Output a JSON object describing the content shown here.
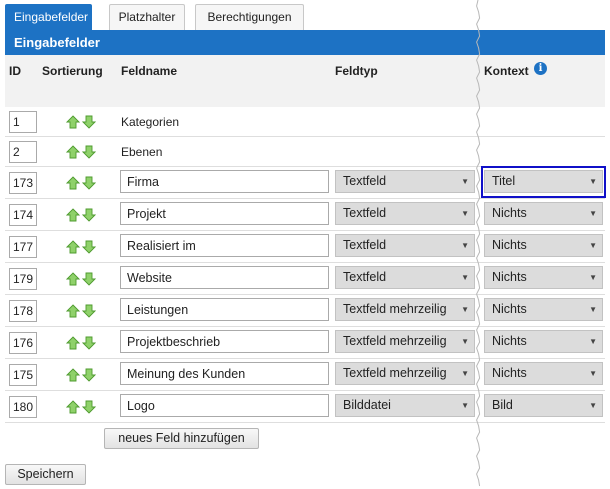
{
  "tabs": [
    {
      "label": "Eingabefelder",
      "active": true
    },
    {
      "label": "Platzhalter",
      "active": false
    },
    {
      "label": "Berechtigungen",
      "active": false
    }
  ],
  "section_title": "Eingabefelder",
  "columns": {
    "id": "ID",
    "sort": "Sortierung",
    "name": "Feldname",
    "type": "Feldtyp",
    "context": "Kontext",
    "context_info_icon": "info-icon"
  },
  "rows": [
    {
      "id": "1",
      "name": "Kategorien",
      "editable": false
    },
    {
      "id": "2",
      "name": "Ebenen",
      "editable": false
    },
    {
      "id": "173",
      "name": "Firma",
      "type": "Textfeld",
      "context": "Titel",
      "editable": true
    },
    {
      "id": "174",
      "name": "Projekt",
      "type": "Textfeld",
      "context": "Nichts",
      "editable": true
    },
    {
      "id": "177",
      "name": "Realisiert im",
      "type": "Textfeld",
      "context": "Nichts",
      "editable": true
    },
    {
      "id": "179",
      "name": "Website",
      "type": "Textfeld",
      "context": "Nichts",
      "editable": true
    },
    {
      "id": "178",
      "name": "Leistungen",
      "type": "Textfeld mehrzeilig",
      "context": "Nichts",
      "editable": true
    },
    {
      "id": "176",
      "name": "Projektbeschrieb",
      "type": "Textfeld mehrzeilig",
      "context": "Nichts",
      "editable": true
    },
    {
      "id": "175",
      "name": "Meinung des Kunden",
      "type": "Textfeld mehrzeilig",
      "context": "Nichts",
      "editable": true
    },
    {
      "id": "180",
      "name": "Logo",
      "type": "Bilddatei",
      "context": "Bild",
      "editable": true
    }
  ],
  "buttons": {
    "add_field": "neues Feld hinzufügen",
    "save": "Speichern"
  },
  "colors": {
    "accent": "#1d72c4",
    "arrow_fill": "#8fd16a",
    "highlight": "#1010c8"
  }
}
